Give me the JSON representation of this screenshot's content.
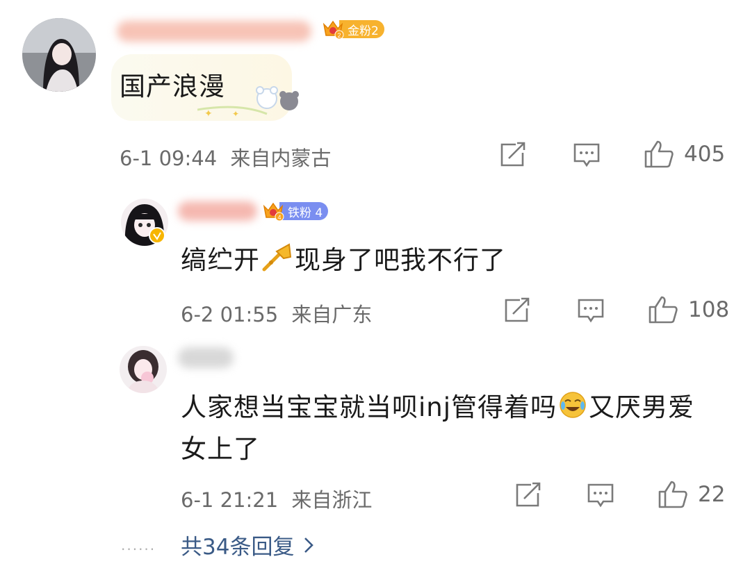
{
  "comments": [
    {
      "badge": "金粉2",
      "text": "国产浪漫",
      "time": "6-1 09:44",
      "location": "来自内蒙古",
      "likes": "405"
    },
    {
      "badge": "铁粉 4",
      "text_before": "缟纻开",
      "text_after": "现身了吧我不行了",
      "time": "6-2 01:55",
      "location": "来自广东",
      "likes": "108"
    },
    {
      "text_line1_before": "人家想当宝宝就当呗inj管得着吗",
      "text_line1_after": "又厌男爱",
      "text_line2": "女上了",
      "time": "6-1 21:21",
      "location": "来自浙江",
      "likes": "22"
    }
  ],
  "more_replies": {
    "dots": "......",
    "label": "共34条回复"
  },
  "icons": [
    "share-icon",
    "comment-icon",
    "like-icon",
    "trumpet-emoji-icon",
    "laugh-cry-emoji-icon",
    "verified-icon",
    "crown-icon",
    "chevron-right-icon"
  ],
  "colors": {
    "gold_badge": "#f7b22e",
    "iron_badge": "#7a8ef0",
    "link": "#3a5a86",
    "meta": "#6a6a6a"
  }
}
